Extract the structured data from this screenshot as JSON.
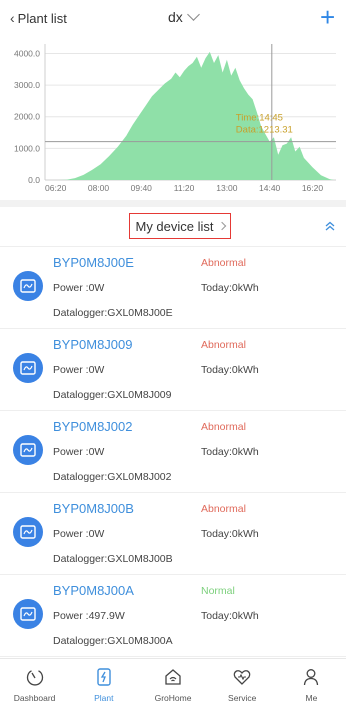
{
  "header": {
    "back_label": "Plant list",
    "plant_name": "dx",
    "add_label": "+"
  },
  "chart_data": {
    "type": "area",
    "color": "#8fe0a8",
    "x_ticks": [
      "06:20",
      "08:00",
      "09:40",
      "11:20",
      "13:00",
      "14:40",
      "16:20"
    ],
    "y_ticks": [
      "0.0",
      "1000.0",
      "2000.0",
      "3000.0",
      "4000.0"
    ],
    "ylim": [
      0,
      4300
    ],
    "xlim_minutes": [
      355,
      1035
    ],
    "x": [
      "06:25",
      "06:45",
      "07:05",
      "07:25",
      "07:45",
      "08:05",
      "08:25",
      "08:45",
      "09:05",
      "09:20",
      "09:35",
      "09:50",
      "10:05",
      "10:20",
      "10:35",
      "10:50",
      "11:00",
      "11:10",
      "11:20",
      "11:30",
      "11:40",
      "11:50",
      "12:00",
      "12:10",
      "12:20",
      "12:30",
      "12:40",
      "12:50",
      "13:00",
      "13:10",
      "13:20",
      "13:30",
      "13:40",
      "13:50",
      "14:00",
      "14:10",
      "14:20",
      "14:30",
      "14:40",
      "14:50",
      "15:00",
      "15:10",
      "15:20",
      "15:30",
      "15:40",
      "15:50",
      "16:00",
      "16:20",
      "16:40",
      "17:00",
      "17:10"
    ],
    "values": [
      0,
      10,
      60,
      160,
      320,
      500,
      760,
      1050,
      1400,
      1750,
      2050,
      2350,
      2650,
      2850,
      3050,
      3200,
      3400,
      3250,
      3450,
      3600,
      3700,
      3900,
      3550,
      3850,
      4050,
      3700,
      3950,
      3400,
      3800,
      3300,
      3550,
      3150,
      2900,
      2700,
      2550,
      2150,
      1700,
      1450,
      1213.31,
      1350,
      800,
      1100,
      1150,
      1350,
      900,
      1050,
      700,
      400,
      150,
      30,
      0
    ],
    "crosshair": {
      "x": "14:45",
      "time_label": "Time:14:45",
      "data_label": "Data:1213.31",
      "crosshair_value": 1213.31
    },
    "accent_color": "#c8a02a"
  },
  "device_list": {
    "title": "My device list"
  },
  "devices": [
    {
      "name": "BYP0M8J00E",
      "status": "Abnormal",
      "status_type": "abnormal",
      "power": "Power :0W",
      "today": "Today:0kWh",
      "logger": "Datalogger:GXL0M8J00E"
    },
    {
      "name": "BYP0M8J009",
      "status": "Abnormal",
      "status_type": "abnormal",
      "power": "Power :0W",
      "today": "Today:0kWh",
      "logger": "Datalogger:GXL0M8J009"
    },
    {
      "name": "BYP0M8J002",
      "status": "Abnormal",
      "status_type": "abnormal",
      "power": "Power :0W",
      "today": "Today:0kWh",
      "logger": "Datalogger:GXL0M8J002"
    },
    {
      "name": "BYP0M8J00B",
      "status": "Abnormal",
      "status_type": "abnormal",
      "power": "Power :0W",
      "today": "Today:0kWh",
      "logger": "Datalogger:GXL0M8J00B"
    },
    {
      "name": "BYP0M8J00A",
      "status": "Normal",
      "status_type": "normal",
      "power": "Power :497.9W",
      "today": "Today:0kWh",
      "logger": "Datalogger:GXL0M8J00A"
    }
  ],
  "tabbar": {
    "items": [
      {
        "label": "Dashboard",
        "icon": "dashboard-icon",
        "active": false
      },
      {
        "label": "Plant",
        "icon": "plant-icon",
        "active": true
      },
      {
        "label": "GroHome",
        "icon": "grohome-icon",
        "active": false
      },
      {
        "label": "Service",
        "icon": "service-icon",
        "active": false
      },
      {
        "label": "Me",
        "icon": "me-icon",
        "active": false
      }
    ]
  },
  "colors": {
    "accent": "#2f87e6",
    "device_name": "#3f8fdc",
    "abnormal": "#e06a5b",
    "normal": "#7dd07d",
    "highlight_border": "#e53935"
  }
}
